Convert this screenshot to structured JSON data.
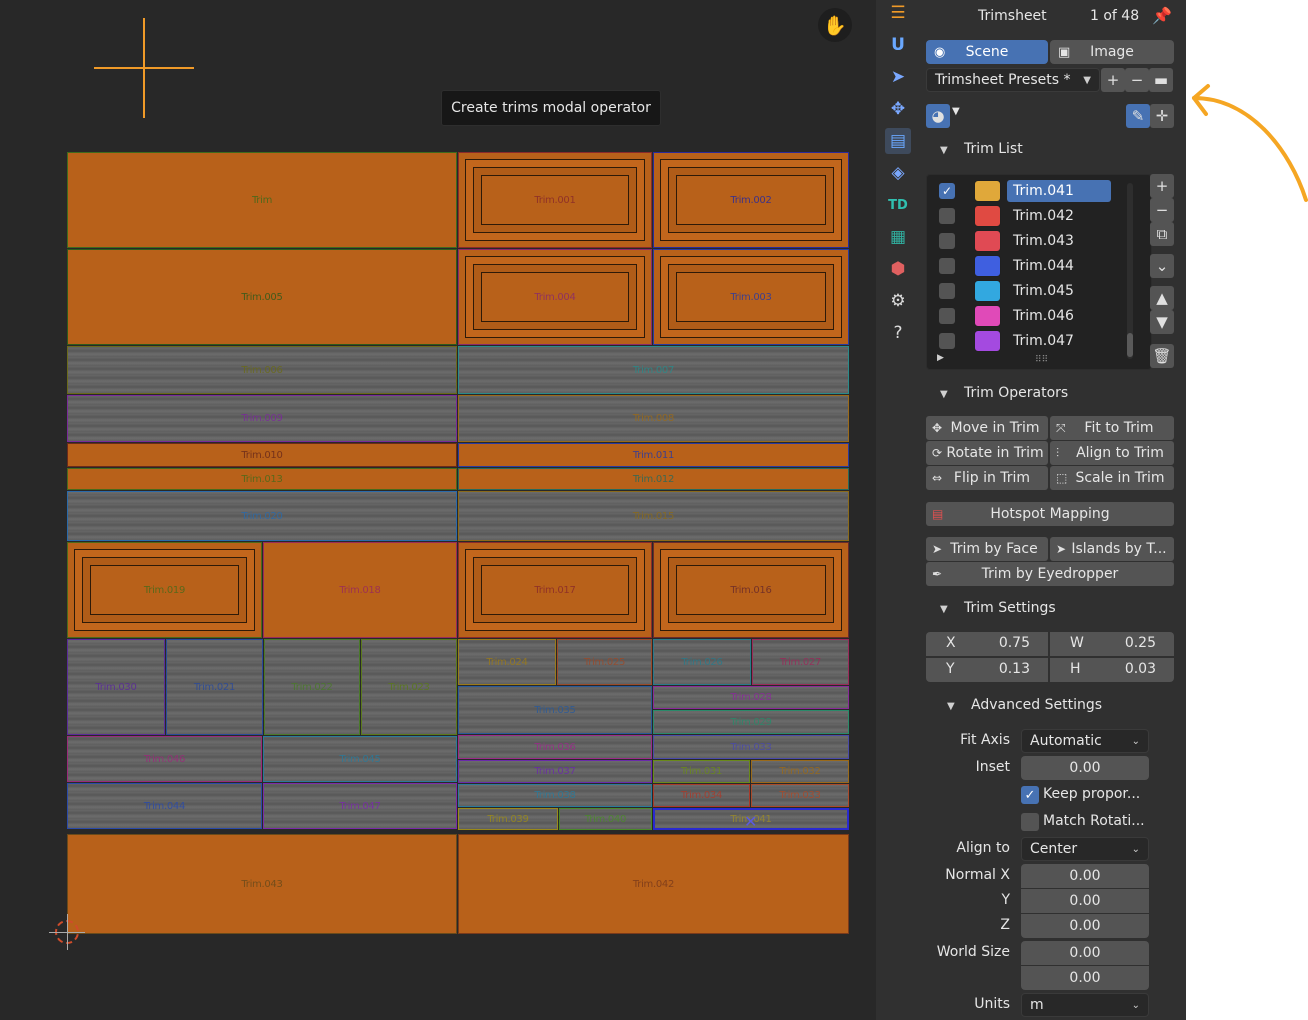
{
  "viewport": {
    "tooltip": "Create trims modal operator",
    "trims": [
      {
        "label": "Trim",
        "style": "orange",
        "color": "#3f6a1c"
      },
      {
        "label": "Trim.001",
        "style": "orange frame",
        "color": "#8a2a2a"
      },
      {
        "label": "Trim.002",
        "style": "orange frame",
        "color": "#2a2a9a"
      },
      {
        "label": "Trim.005",
        "style": "orange",
        "color": "#2f5a1a"
      },
      {
        "label": "Trim.004",
        "style": "orange frame",
        "color": "#8a2a6a"
      },
      {
        "label": "Trim.003",
        "style": "orange frame",
        "color": "#2a3aa0"
      },
      {
        "label": "Trim.006",
        "style": "concrete",
        "color": "#6a6a1a"
      },
      {
        "label": "Trim.007",
        "style": "concrete",
        "color": "#2a8a8a"
      },
      {
        "label": "Trim.009",
        "style": "concrete",
        "color": "#7a2a9a"
      },
      {
        "label": "Trim.008",
        "style": "concrete",
        "color": "#9a6a1a"
      },
      {
        "label": "Trim.010",
        "style": "orange",
        "color": "#6a2a1a"
      },
      {
        "label": "Trim.011",
        "style": "orange",
        "color": "#2a3aa0"
      },
      {
        "label": "Trim.013",
        "style": "orange",
        "color": "#4a6a1a"
      },
      {
        "label": "Trim.012",
        "style": "orange",
        "color": "#2a6a5a"
      },
      {
        "label": "Trim.020",
        "style": "concrete",
        "color": "#2a6aaa"
      },
      {
        "label": "Trim.015",
        "style": "concrete",
        "color": "#8a6a1a"
      },
      {
        "label": "Trim.019",
        "style": "orange frame",
        "color": "#4a6a1a"
      },
      {
        "label": "Trim.018",
        "style": "orange",
        "color": "#9a2a5a"
      },
      {
        "label": "Trim.017",
        "style": "orange frame",
        "color": "#8a2a2a"
      },
      {
        "label": "Trim.016",
        "style": "orange frame",
        "color": "#6a2a2a"
      },
      {
        "label": "Trim.030",
        "style": "concrete",
        "color": "#5a2a9a"
      },
      {
        "label": "Trim.021",
        "style": "concrete",
        "color": "#2a4a9a"
      },
      {
        "label": "Trim.022",
        "style": "concrete",
        "color": "#4a7a2a"
      },
      {
        "label": "Trim.023",
        "style": "concrete",
        "color": "#5a7a1a"
      },
      {
        "label": "Trim.024",
        "style": "concrete",
        "color": "#9a7a1a"
      },
      {
        "label": "Trim.025",
        "style": "concrete",
        "color": "#9a4a2a"
      },
      {
        "label": "Trim.026",
        "style": "concrete",
        "color": "#2a7a8a"
      },
      {
        "label": "Trim.027",
        "style": "concrete",
        "color": "#9a2a5a"
      },
      {
        "label": "Trim.035",
        "style": "concrete",
        "color": "#2a5a9a"
      },
      {
        "label": "Trim.028",
        "style": "concrete",
        "color": "#8a2a9a"
      },
      {
        "label": "Trim.029",
        "style": "concrete",
        "color": "#2a8a6a"
      },
      {
        "label": "Trim.046",
        "style": "concrete",
        "color": "#9a2a7a"
      },
      {
        "label": "Trim.045",
        "style": "concrete",
        "color": "#2a7a9a"
      },
      {
        "label": "Trim.036",
        "style": "concrete",
        "color": "#9a2a8a"
      },
      {
        "label": "Trim.033",
        "style": "concrete",
        "color": "#4a4aaa"
      },
      {
        "label": "Trim.037",
        "style": "concrete",
        "color": "#6a2aaa"
      },
      {
        "label": "Trim.031",
        "style": "concrete",
        "color": "#6a8a1a"
      },
      {
        "label": "Trim.032",
        "style": "concrete",
        "color": "#9a6a1a"
      },
      {
        "label": "Trim.044",
        "style": "concrete",
        "color": "#2a4aaa"
      },
      {
        "label": "Trim.047",
        "style": "concrete",
        "color": "#7a2aaa"
      },
      {
        "label": "Trim.038",
        "style": "concrete",
        "color": "#2a7a9a"
      },
      {
        "label": "Trim.034",
        "style": "concrete",
        "color": "#aa3a2a"
      },
      {
        "label": "Trim.033",
        "style": "concrete",
        "color": "#aa4a2a"
      },
      {
        "label": "Trim.039",
        "style": "concrete",
        "color": "#9a8a1a"
      },
      {
        "label": "Trim.040",
        "style": "concrete",
        "color": "#4a8a2a"
      },
      {
        "label": "Trim.041",
        "style": "concrete",
        "color": "#9a8a2a"
      },
      {
        "label": "Trim.043",
        "style": "orange",
        "color": "#6a4a1a"
      },
      {
        "label": "Trim.042",
        "style": "orange",
        "color": "#7a3a1a"
      }
    ]
  },
  "toolstrip": {
    "tools": [
      {
        "icon": "list-icon",
        "glyph": "☰"
      },
      {
        "icon": "uv-icon",
        "glyph": "U"
      },
      {
        "icon": "select-icon",
        "glyph": "➤"
      },
      {
        "icon": "move-icon",
        "glyph": "✥"
      },
      {
        "icon": "trimsheet-icon",
        "glyph": "▤",
        "active": true
      },
      {
        "icon": "layers-icon",
        "glyph": "◈"
      },
      {
        "icon": "td-icon",
        "glyph": "TD"
      },
      {
        "icon": "checker-icon",
        "glyph": "▦"
      },
      {
        "icon": "package-icon",
        "glyph": "⬢"
      },
      {
        "icon": "gear-icon",
        "glyph": "⚙"
      },
      {
        "icon": "help-icon",
        "glyph": "?"
      }
    ]
  },
  "panel": {
    "title": "Trimsheet",
    "count": "1 of 48",
    "scene_tab": "Scene",
    "image_tab": "Image",
    "presets": "Trimsheet Presets *",
    "trim_list_header": "Trim List",
    "trims": [
      {
        "name": "Trim.041",
        "color": "#e0a83a",
        "checked": true,
        "selected": true
      },
      {
        "name": "Trim.042",
        "color": "#e04a42",
        "checked": false,
        "selected": false
      },
      {
        "name": "Trim.043",
        "color": "#e04a54",
        "checked": false,
        "selected": false
      },
      {
        "name": "Trim.044",
        "color": "#3f5fe0",
        "checked": false,
        "selected": false
      },
      {
        "name": "Trim.045",
        "color": "#32a8e0",
        "checked": false,
        "selected": false
      },
      {
        "name": "Trim.046",
        "color": "#e04ab8",
        "checked": false,
        "selected": false
      },
      {
        "name": "Trim.047",
        "color": "#a44ae0",
        "checked": false,
        "selected": false
      }
    ],
    "trim_operators_header": "Trim Operators",
    "ops": {
      "move_in_trim": "Move in Trim",
      "fit_to_trim": "Fit to Trim",
      "rotate_in_trim": "Rotate in Trim",
      "align_to_trim": "Align to Trim",
      "flip_in_trim": "Flip in Trim",
      "scale_in_trim": "Scale in Trim",
      "hotspot_mapping": "Hotspot Mapping",
      "trim_by_face": "Trim by Face",
      "islands_by_trim": "Islands by T...",
      "trim_by_eyedropper": "Trim by Eyedropper"
    },
    "trim_settings_header": "Trim Settings",
    "settings": {
      "x_label": "X",
      "x_value": "0.75",
      "w_label": "W",
      "w_value": "0.25",
      "y_label": "Y",
      "y_value": "0.13",
      "h_label": "H",
      "h_value": "0.03"
    },
    "advanced_header": "Advanced Settings",
    "advanced": {
      "fit_axis_label": "Fit Axis",
      "fit_axis_value": "Automatic",
      "inset_label": "Inset",
      "inset_value": "0.00",
      "keep_proportions": "Keep propor...",
      "keep_proportions_checked": true,
      "match_rotation": "Match Rotati...",
      "match_rotation_checked": false,
      "align_to_label": "Align to",
      "align_to_value": "Center",
      "normal_x_label": "Normal X",
      "normal_x_value": "0.00",
      "normal_y_label": "Y",
      "normal_y_value": "0.00",
      "normal_z_label": "Z",
      "normal_z_value": "0.00",
      "world_size_label": "World Size",
      "world_size_value1": "0.00",
      "world_size_value2": "0.00",
      "units_label": "Units",
      "units_value": "m"
    }
  },
  "colors": {
    "accent": "#4772b3",
    "annotation": "#f5a623",
    "panel_bg": "#303030",
    "viewport_bg": "#282828"
  }
}
